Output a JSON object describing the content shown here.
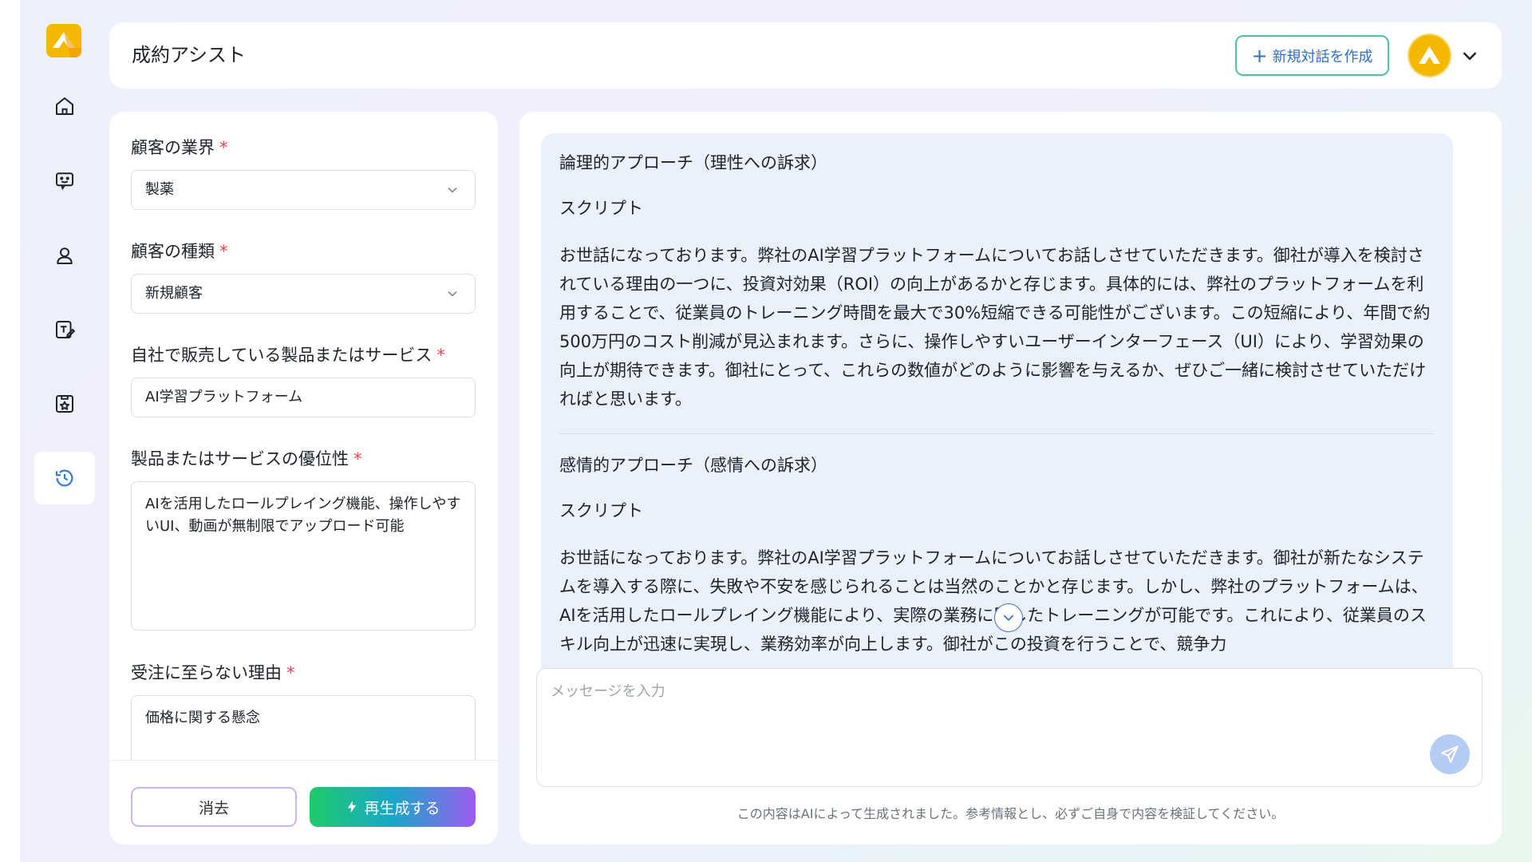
{
  "app": {
    "title": "成約アシスト"
  },
  "header": {
    "new_chat_label": "新規対話を作成",
    "new_chat_icon": "plus-icon"
  },
  "sidebar": {
    "items": [
      {
        "name": "home",
        "icon": "home-icon"
      },
      {
        "name": "chat",
        "icon": "chat-bubble-icon"
      },
      {
        "name": "customer",
        "icon": "user-icon"
      },
      {
        "name": "edit",
        "icon": "edit-text-icon"
      },
      {
        "name": "evaluation",
        "icon": "star-box-icon"
      },
      {
        "name": "history",
        "icon": "history-icon",
        "active": true
      }
    ]
  },
  "form": {
    "industry": {
      "label": "顧客の業界",
      "required_mark": "*",
      "value": "製薬"
    },
    "customer_type": {
      "label": "顧客の種類",
      "required_mark": "*",
      "value": "新規顧客"
    },
    "product": {
      "label": "自社で販売している製品またはサービス",
      "required_mark": "*",
      "value": "AI学習プラットフォーム"
    },
    "advantage": {
      "label": "製品またはサービスの優位性",
      "required_mark": "*",
      "value": "AIを活用したロールプレイング機能、操作しやすいUI、動画が無制限でアップロード可能"
    },
    "reason": {
      "label": "受注に至らない理由",
      "required_mark": "*",
      "value": "価格に関する懸念"
    },
    "clear_label": "消去",
    "regenerate_label": "再生成する"
  },
  "chat": {
    "sections": [
      {
        "heading": "論理的アプローチ（理性への訴求）",
        "sub": "スクリプト",
        "body": "お世話になっております。弊社のAI学習プラットフォームについてお話しさせていただきます。御社が導入を検討されている理由の一つに、投資対効果（ROI）の向上があるかと存じます。具体的には、弊社のプラットフォームを利用することで、従業員のトレーニング時間を最大で30%短縮できる可能性がございます。この短縮により、年間で約500万円のコスト削減が見込まれます。さらに、操作しやすいユーザーインターフェース（UI）により、学習効果の向上が期待できます。御社にとって、これらの数値がどのように影響を与えるか、ぜひご一緒に検討させていただければと思います。"
      },
      {
        "heading": "感情的アプローチ（感情への訴求）",
        "sub": "スクリプト",
        "body": "お世話になっております。弊社のAI学習プラットフォームについてお話しさせていただきます。御社が新たなシステムを導入する際に、失敗や不安を感じられることは当然のことかと存じます。しかし、弊社のプラットフォームは、AIを活用したロールプレイング機能により、実際の業務に即したトレーニングが可能です。これにより、従業員のスキル向上が迅速に実現し、業務効率が向上します。御社がこの投資を行うことで、競争力"
      }
    ],
    "input_placeholder": "メッセージを入力",
    "disclaimer": "この内容はAIによって生成されました。参考情報とし、必ずご自身で内容を検証してください。"
  },
  "colors": {
    "brand_yellow": "#f5b800",
    "required_red": "#e5484d",
    "accent_blue": "#2f6fcf",
    "bubble_bg": "#eaf1fb"
  }
}
